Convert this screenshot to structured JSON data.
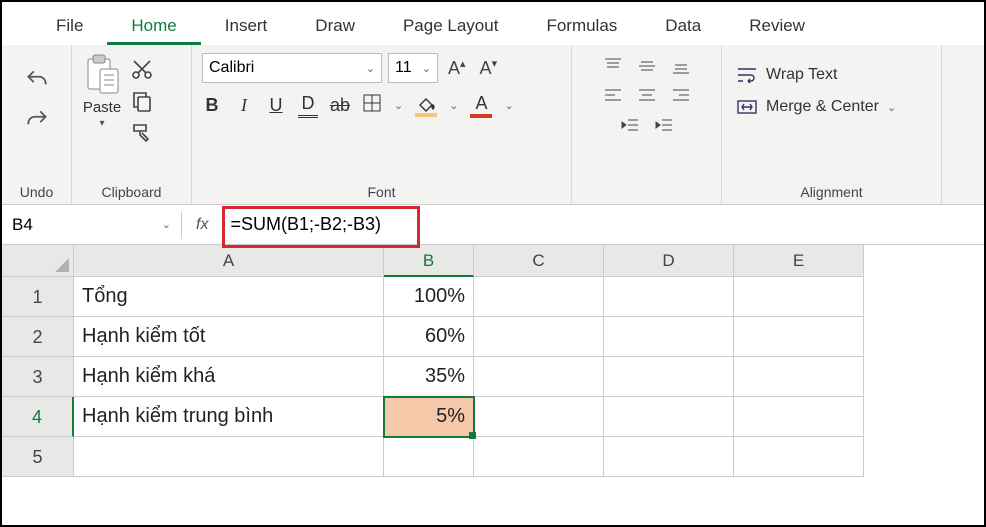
{
  "tabs": [
    "File",
    "Home",
    "Insert",
    "Draw",
    "Page Layout",
    "Formulas",
    "Data",
    "Review"
  ],
  "activeTab": "Home",
  "ribbon": {
    "undoLabel": "Undo",
    "clipboard": {
      "pasteLabel": "Paste",
      "groupLabel": "Clipboard"
    },
    "font": {
      "name": "Calibri",
      "size": "11",
      "groupLabel": "Font"
    },
    "alignment": {
      "wrapLabel": "Wrap Text",
      "mergeLabel": "Merge & Center",
      "groupLabel": "Alignment"
    }
  },
  "nameBox": "B4",
  "formula": "=SUM(B1;-B2;-B3)",
  "columns": [
    "A",
    "B",
    "C",
    "D",
    "E"
  ],
  "rows": [
    {
      "n": "1",
      "A": "Tổng",
      "B": "100%"
    },
    {
      "n": "2",
      "A": "Hạnh kiểm tốt",
      "B": "60%"
    },
    {
      "n": "3",
      "A": "Hạnh kiểm khá",
      "B": "35%"
    },
    {
      "n": "4",
      "A": "Hạnh kiểm trung bình",
      "B": "5%"
    },
    {
      "n": "5",
      "A": "",
      "B": ""
    }
  ]
}
